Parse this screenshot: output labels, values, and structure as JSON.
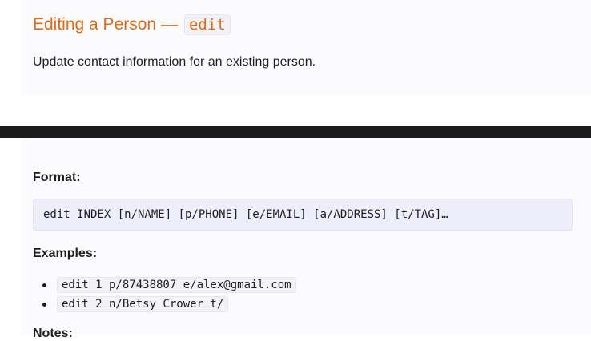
{
  "header": {
    "title_text": "Editing a Person —",
    "title_code": "edit",
    "description": "Update contact information for an existing person."
  },
  "format": {
    "label": "Format:",
    "command": "edit INDEX [n/NAME] [p/PHONE] [e/EMAIL] [a/ADDRESS] [t/TAG]…"
  },
  "examples": {
    "label": "Examples:",
    "items": [
      "edit 1 p/87438807 e/alex@gmail.com",
      "edit 2 n/Betsy Crower t/"
    ]
  },
  "notes": {
    "label": "Notes:"
  },
  "colors": {
    "title": "#e06c12",
    "code_block_bg": "#eeeefb",
    "dark_bar": "#1c1c1c"
  }
}
